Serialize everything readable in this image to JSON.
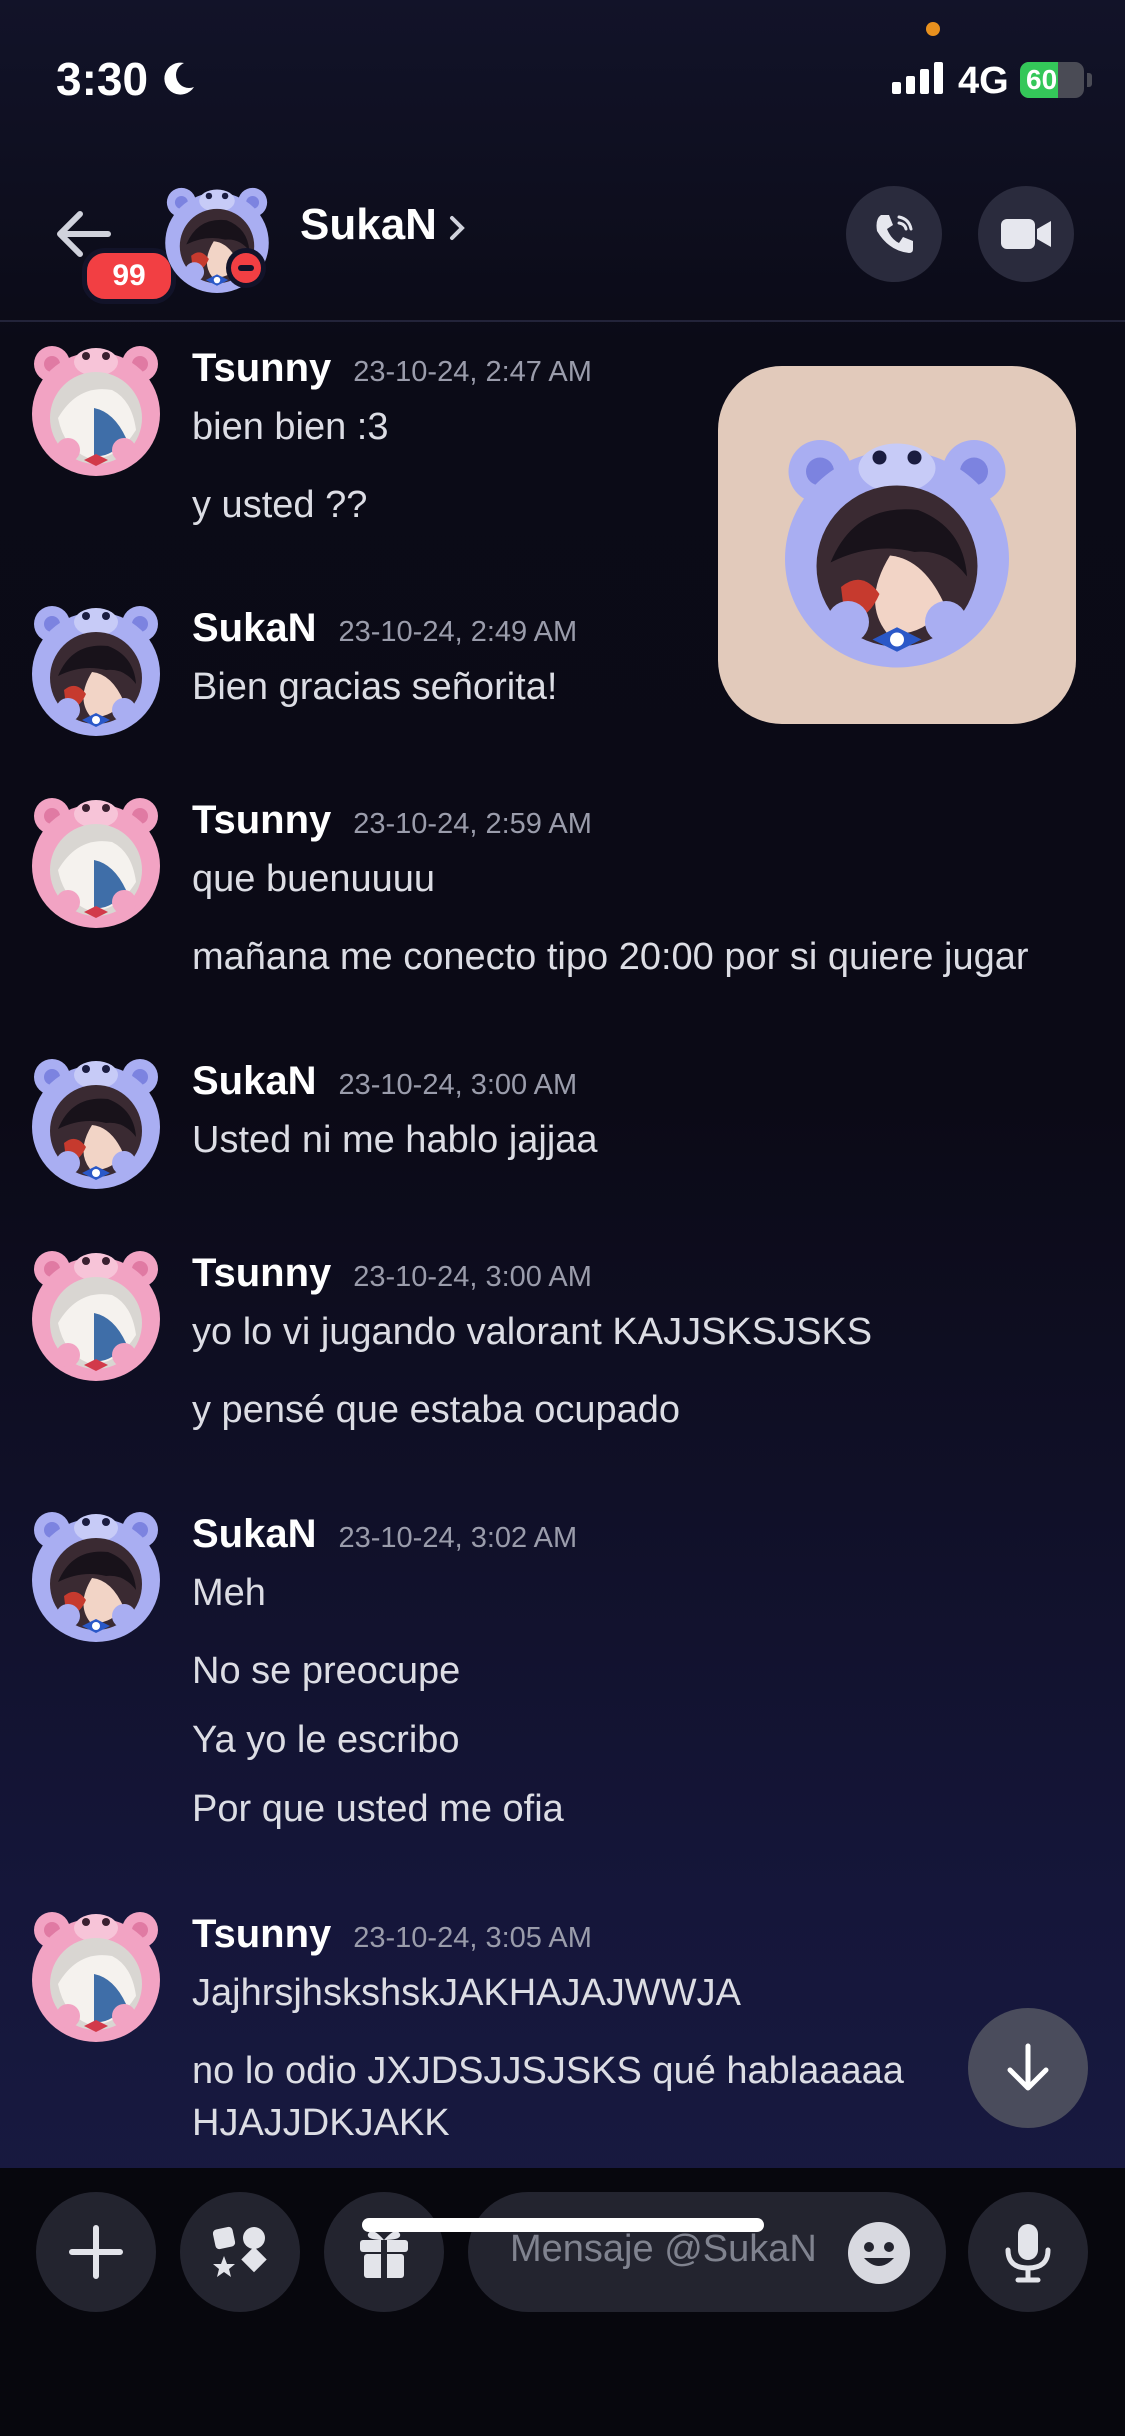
{
  "status_bar": {
    "time": "3:30",
    "network": "4G",
    "battery": "60",
    "battery_level": 0.6
  },
  "header": {
    "unread_badge": "99",
    "title": "SukaN"
  },
  "messages": [
    {
      "author": "Tsunny",
      "time": "23-10-24, 2:47 AM",
      "lines": [
        "bien bien :3",
        "y usted ??"
      ]
    },
    {
      "author": "SukaN",
      "time": "23-10-24, 2:49 AM",
      "lines": [
        "Bien gracias señorita!"
      ]
    },
    {
      "author": "Tsunny",
      "time": "23-10-24, 2:59 AM",
      "lines": [
        "que buenuuuu",
        "mañana me conecto tipo 20:00 por si quiere jugar"
      ]
    },
    {
      "author": "SukaN",
      "time": "23-10-24, 3:00 AM",
      "lines": [
        "Usted ni me hablo jajjaa"
      ]
    },
    {
      "author": "Tsunny",
      "time": "23-10-24, 3:00 AM",
      "lines": [
        "yo lo vi jugando valorant KAJJSKSJSKS",
        "y pensé que estaba ocupado"
      ]
    },
    {
      "author": "SukaN",
      "time": "23-10-24, 3:02 AM",
      "lines": [
        "Meh",
        "No se preocupe",
        "Ya yo le escribo",
        "Por que usted me ofia"
      ]
    },
    {
      "author": "Tsunny",
      "time": "23-10-24, 3:05 AM",
      "lines": [
        "JajhrsjhskshskJAKHAJAJWWJA",
        "no lo odio JXJDSJJSJSKS qué hablaaaaa",
        "HJAJJDKJAKK"
      ]
    }
  ],
  "composer": {
    "placeholder": "Mensaje @SukaN"
  },
  "colors": {
    "pink_bear": "#f2a3c3",
    "blue_bear": "#a9aef2",
    "accent_red": "#f23f43"
  }
}
